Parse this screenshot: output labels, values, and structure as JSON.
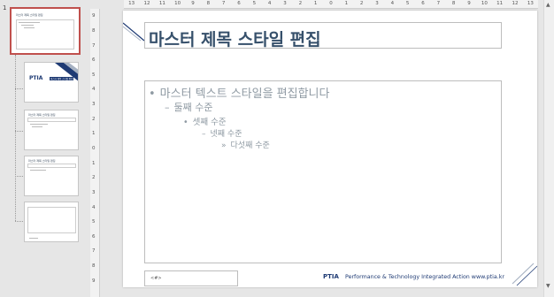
{
  "thumbnails": {
    "first_slide_number": "1",
    "items": [
      {
        "title": "마스터 제목 스타일 편집"
      },
      {
        "title": "PTIA",
        "subtitle": "마스터 제목 스타일 편집"
      },
      {
        "title": "마스터 제목 스타일 편집"
      },
      {
        "title": "마스터 제목 스타일 편집"
      },
      {
        "title": ""
      }
    ]
  },
  "ruler": {
    "horizontal": [
      "13",
      "12",
      "11",
      "10",
      "9",
      "8",
      "7",
      "6",
      "5",
      "4",
      "3",
      "2",
      "1",
      "0",
      "1",
      "2",
      "3",
      "4",
      "5",
      "6",
      "7",
      "8",
      "9",
      "10",
      "11",
      "12",
      "13"
    ],
    "vertical": [
      "9",
      "8",
      "7",
      "6",
      "5",
      "4",
      "3",
      "2",
      "1",
      "0",
      "1",
      "2",
      "3",
      "4",
      "5",
      "6",
      "7",
      "8",
      "9"
    ]
  },
  "slide": {
    "title": "마스터 제목 스타일 편집",
    "levels": [
      {
        "marker": "•",
        "text": "마스터 텍스트 스타일을 편집합니다"
      },
      {
        "marker": "–",
        "text": "둘째 수준"
      },
      {
        "marker": "•",
        "text": "셋째 수준"
      },
      {
        "marker": "–",
        "text": "넷째 수준"
      },
      {
        "marker": "»",
        "text": "다섯째 수준"
      }
    ],
    "footer_placeholder": "<#>",
    "logo": "PTIA",
    "tagline": "Performance & Technology Integrated Action www.ptia.kr"
  },
  "colors": {
    "accent_border": "#c0504d",
    "title": "#36506b",
    "brand": "#1f3b74",
    "stripe_dark": "#1f3b74",
    "stripe_light": "#a8b3c3"
  }
}
